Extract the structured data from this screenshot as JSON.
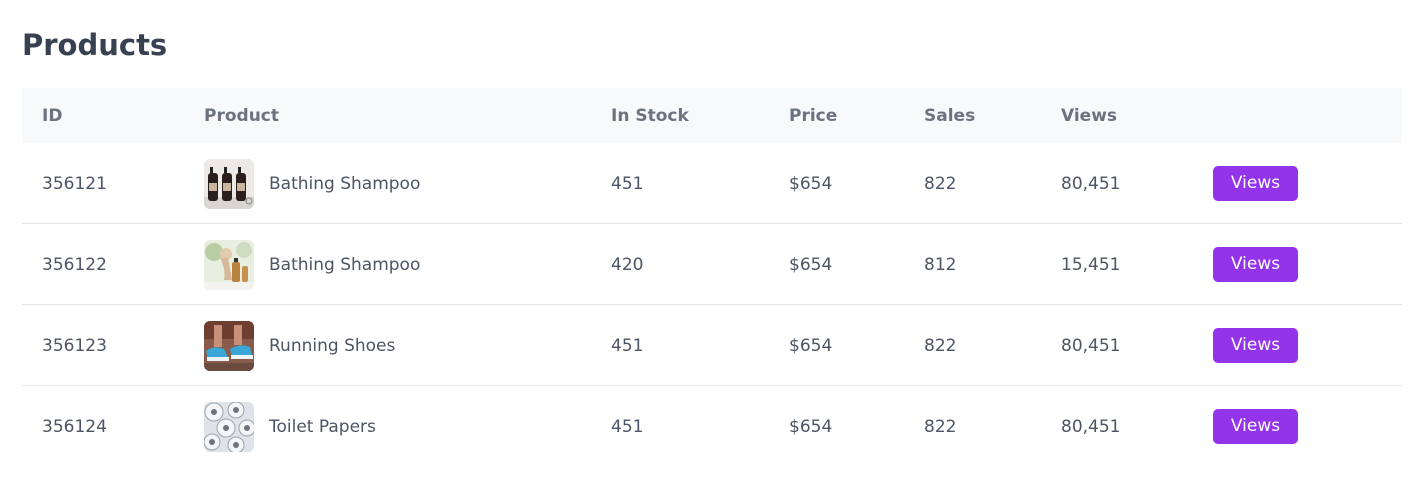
{
  "page": {
    "title": "Products"
  },
  "table": {
    "columns": {
      "id": "ID",
      "product": "Product",
      "in_stock": "In Stock",
      "price": "Price",
      "sales": "Sales",
      "views": "Views"
    },
    "rows": [
      {
        "id": "356121",
        "product": "Bathing Shampoo",
        "in_stock": "451",
        "price": "$654",
        "sales": "822",
        "views": "80,451",
        "action": "Views",
        "thumbnail": "shampoo-bottles-image"
      },
      {
        "id": "356122",
        "product": "Bathing Shampoo",
        "in_stock": "420",
        "price": "$654",
        "sales": "812",
        "views": "15,451",
        "action": "Views",
        "thumbnail": "shampoo-shower-image"
      },
      {
        "id": "356123",
        "product": "Running Shoes",
        "in_stock": "451",
        "price": "$654",
        "sales": "822",
        "views": "80,451",
        "action": "Views",
        "thumbnail": "running-shoes-image"
      },
      {
        "id": "356124",
        "product": "Toilet Papers",
        "in_stock": "451",
        "price": "$654",
        "sales": "822",
        "views": "80,451",
        "action": "Views",
        "thumbnail": "toilet-paper-rolls-image"
      }
    ]
  },
  "colors": {
    "title": "#374151",
    "header_bg": "#f8f9fb",
    "header_text": "#6b7280",
    "body_text": "#4b5563",
    "button_bg": "#9333ea",
    "button_text": "#ffffff",
    "row_divider": "#e5e7eb"
  }
}
